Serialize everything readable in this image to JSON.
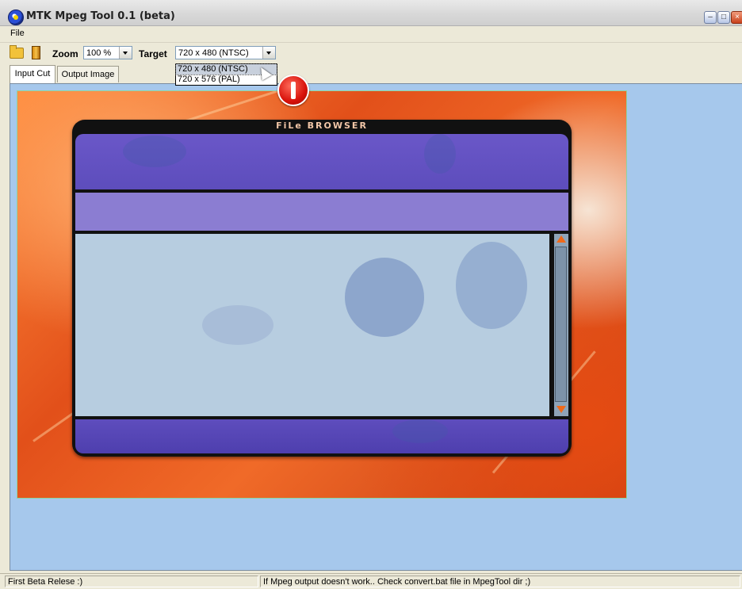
{
  "window": {
    "title": "MTK Mpeg Tool 0.1 (beta)"
  },
  "menu": {
    "file": "File"
  },
  "toolbar": {
    "zoom_label": "Zoom",
    "zoom_value": "100 %",
    "target_label": "Target",
    "target_value": "720 x 480 (NTSC)"
  },
  "dropdown": {
    "options": [
      "720 x 480 (NTSC)",
      "720 x 576 (PAL)"
    ],
    "selected_index": 0
  },
  "tabs": [
    "Input Cut",
    "Output Image"
  ],
  "active_tab": "Input Cut",
  "preview": {
    "panel_title": "FiLe BROWSER"
  },
  "status": {
    "left": "First Beta Relese :)",
    "right": "If Mpeg output doesn't work.. Check convert.bat file in MpegTool dir ;)"
  },
  "colors": {
    "workspace": "#a6c8ec",
    "panel_purple": "#6a57c8",
    "alert_red": "#d8120b"
  }
}
